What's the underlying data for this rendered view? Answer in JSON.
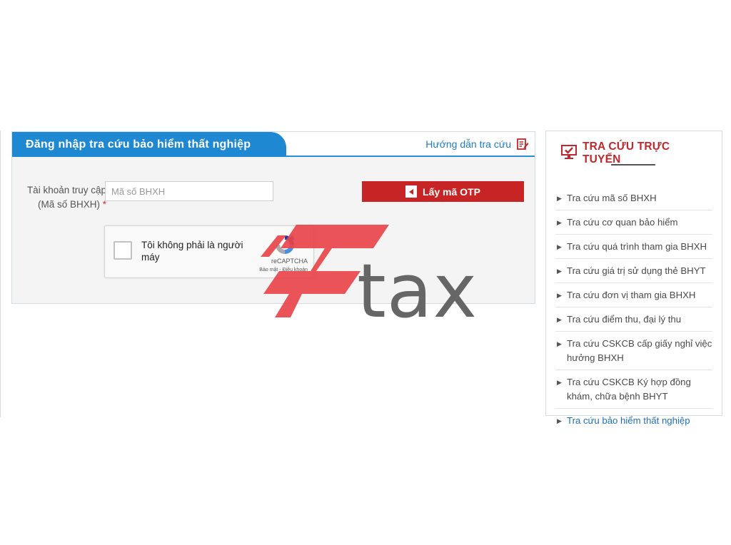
{
  "login_panel": {
    "title": "Đăng nhập tra cứu bảo hiểm thất nghiệp",
    "guide_link": "Hướng dẫn tra cứu",
    "account_label_line1": "Tài khoản truy cập",
    "account_label_line2": "(Mã số BHXH)",
    "required_mark": "*",
    "account_placeholder": "Mã số BHXH",
    "account_value": "",
    "otp_button": "Lấy mã OTP"
  },
  "captcha": {
    "label": "Tôi không phải là người máy",
    "brand": "reCAPTCHA",
    "terms": "Bảo mật - Điều khoản"
  },
  "sidebar": {
    "title": "TRA CỨU TRỰC TUYẾN",
    "items": [
      {
        "label": "Tra cứu mã số BHXH"
      },
      {
        "label": "Tra cứu cơ quan bảo hiểm"
      },
      {
        "label": "Tra cứu quá trình tham gia BHXH"
      },
      {
        "label": "Tra cứu giá trị sử dụng thẻ BHYT"
      },
      {
        "label": "Tra cứu đơn vị tham gia BHXH"
      },
      {
        "label": "Tra cứu điểm thu, đại lý thu"
      },
      {
        "label": "Tra cứu CSKCB cấp giấy nghỉ việc hưởng BHXH"
      },
      {
        "label": "Tra cứu CSKCB Ký hợp đồng khám, chữa bệnh BHYT"
      },
      {
        "label": "Tra cứu bảo hiểm thất nghiệp"
      }
    ],
    "active_index": 8
  },
  "watermark": {
    "text": "tax"
  },
  "colors": {
    "tab_blue": "#1f88d3",
    "otp_red": "#c72525",
    "sidebar_title_red": "#c0282d",
    "link_blue": "#1f7bc4",
    "watermark_red": "#e8454a"
  },
  "icons": {
    "guide": "edit-document-icon",
    "otp": "door-exit-icon",
    "sidebar_title": "monitor-check-icon",
    "bullet": "triangle-right-icon"
  }
}
